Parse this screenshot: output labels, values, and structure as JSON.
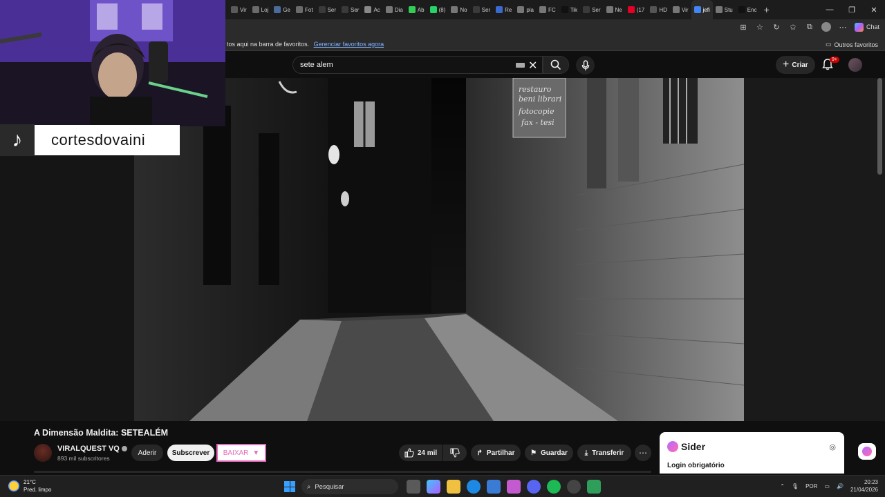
{
  "browser": {
    "tabs": [
      {
        "label": "Vir",
        "color": "#5a5a5a"
      },
      {
        "label": "Loj",
        "color": "#6b6b6b"
      },
      {
        "label": "Ge",
        "color": "#4b6b9b"
      },
      {
        "label": "Fot",
        "color": "#6b6b6b"
      },
      {
        "label": "Ser",
        "color": "#3a3a3a"
      },
      {
        "label": "Ser",
        "color": "#3a3a3a"
      },
      {
        "label": "Ac",
        "color": "#888888"
      },
      {
        "label": "Dia",
        "color": "#777777"
      },
      {
        "label": "Ab",
        "color": "#33cc55"
      },
      {
        "label": "(8)",
        "color": "#25d366"
      },
      {
        "label": "No",
        "color": "#777777"
      },
      {
        "label": "Ser",
        "color": "#3a3a3a"
      },
      {
        "label": "Re",
        "color": "#3a6ad0"
      },
      {
        "label": "pla",
        "color": "#777777"
      },
      {
        "label": "FC",
        "color": "#777777"
      },
      {
        "label": "Tik",
        "color": "#111111"
      },
      {
        "label": "Ser",
        "color": "#3a3a3a"
      },
      {
        "label": "Ne",
        "color": "#777777"
      },
      {
        "label": "(17",
        "color": "#e60023"
      },
      {
        "label": "HD",
        "color": "#555555"
      },
      {
        "label": "Vir",
        "color": "#777777"
      },
      {
        "label": "jefi",
        "color": "#4285f4",
        "active": true
      },
      {
        "label": "Stu",
        "color": "#777777"
      },
      {
        "label": "Enc",
        "color": "#111111"
      }
    ],
    "chat_label": "Chat",
    "favbar_msg": "tos aqui na barra de favoritos.",
    "favbar_link": "Gerenciar favoritos agora",
    "other_favs": "Outros favoritos"
  },
  "overlay": {
    "tiktok_handle": "cortesdovaini"
  },
  "youtube": {
    "search_value": "sete alem",
    "create_label": "Criar",
    "notif_badge": "9+",
    "video_title": "A Dimensão Maldita: SETEALÉM",
    "channel_name": "VIRALQUEST VQ",
    "subscribers": "893 mil subscritores",
    "join_label": "Aderir",
    "subscribe_label": "Subscrever",
    "baixar_label": "BAIXAR",
    "likes": "24 mil",
    "share_label": "Partilhar",
    "save_label": "Guardar",
    "download_label": "Transferir"
  },
  "sider": {
    "title": "Sider",
    "login": "Login obrigatório"
  },
  "taskbar": {
    "temp": "21°C",
    "weather": "Pred. limpo",
    "search": "Pesquisar",
    "lang": "POR",
    "time": "20:23",
    "date": "21/04/2026"
  }
}
